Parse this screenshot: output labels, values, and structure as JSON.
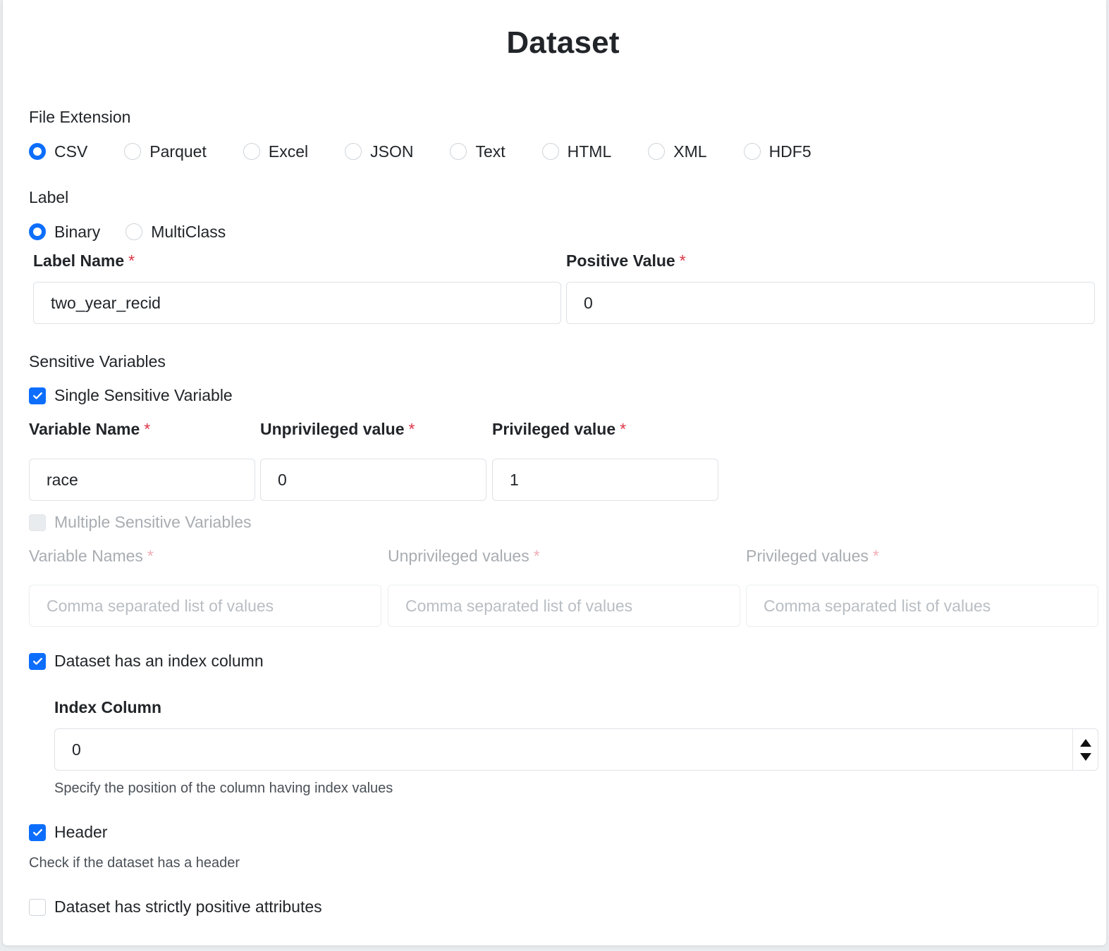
{
  "title": "Dataset",
  "file_extension": {
    "label": "File Extension",
    "options": [
      "CSV",
      "Parquet",
      "Excel",
      "JSON",
      "Text",
      "HTML",
      "XML",
      "HDF5"
    ],
    "selected": "CSV"
  },
  "label_section": {
    "label": "Label",
    "options": [
      "Binary",
      "MultiClass"
    ],
    "selected": "Binary",
    "label_name": {
      "label": "Label Name",
      "required": "*",
      "value": "two_year_recid"
    },
    "positive_value": {
      "label": "Positive Value",
      "required": "*",
      "value": "0"
    }
  },
  "sensitive": {
    "label": "Sensitive Variables",
    "single": {
      "label": "Single Sensitive Variable",
      "checked": true,
      "variable_name": {
        "label": "Variable Name",
        "required": "*",
        "value": "race"
      },
      "unprivileged": {
        "label": "Unprivileged value",
        "required": "*",
        "value": "0"
      },
      "privileged": {
        "label": "Privileged value",
        "required": "*",
        "value": "1"
      }
    },
    "multiple": {
      "label": "Multiple Sensitive Variables",
      "checked": false,
      "disabled": true,
      "variable_names": {
        "label": "Variable Names",
        "required": "*",
        "placeholder": "Comma separated list of values"
      },
      "unprivileged": {
        "label": "Unprivileged values",
        "required": "*",
        "placeholder": "Comma separated list of values"
      },
      "privileged": {
        "label": "Privileged values",
        "required": "*",
        "placeholder": "Comma separated list of values"
      }
    }
  },
  "index": {
    "label": "Dataset has an index column",
    "checked": true,
    "column_label": "Index Column",
    "column_value": "0",
    "help": "Specify the position of the column having index values"
  },
  "header": {
    "label": "Header",
    "checked": true,
    "help": "Check if the dataset has a header"
  },
  "positive_attrs": {
    "label": "Dataset has strictly positive attributes",
    "checked": false
  },
  "colors": {
    "accent": "#0d6efd",
    "required": "#dc3545"
  }
}
